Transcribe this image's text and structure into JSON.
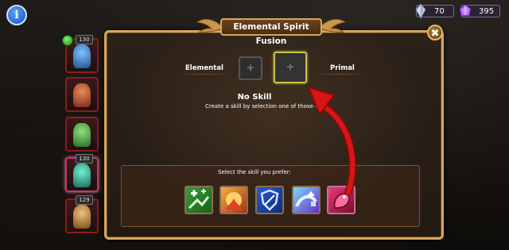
{
  "window": {
    "title": "Elemental Spirit Fusion",
    "close_symbol": "✖"
  },
  "currencies": [
    {
      "icon": "crystal-icon",
      "value": "70"
    },
    {
      "icon": "gem-icon",
      "value": "395"
    }
  ],
  "heroes": [
    {
      "level": "130",
      "has_gem": true,
      "color": "#3a8bd0"
    },
    {
      "level": "",
      "has_gem": false,
      "color": "#c9463a"
    },
    {
      "level": "",
      "has_gem": false,
      "color": "#3aa04a"
    },
    {
      "level": "130",
      "has_gem": false,
      "color": "#2ac0a0",
      "selected": true
    },
    {
      "level": "129",
      "has_gem": false,
      "color": "#c08a3a"
    }
  ],
  "fusion": {
    "left_label": "Elemental",
    "right_label": "Primal",
    "plus_symbol": "+",
    "result_title": "No Skill",
    "result_hint": "Create a skill by selection one of those offe"
  },
  "selection": {
    "prompt": "Select the skill you prefer:",
    "skills": [
      {
        "icon": "heal-plus-icon"
      },
      {
        "icon": "fire-burst-icon"
      },
      {
        "icon": "shield-icon"
      },
      {
        "icon": "water-heal-icon"
      },
      {
        "icon": "pink-fist-icon"
      }
    ]
  },
  "colors": {
    "panel_border": "#d5a65a",
    "arrow": "#d91515",
    "selected_slot": "#c7c24a"
  }
}
